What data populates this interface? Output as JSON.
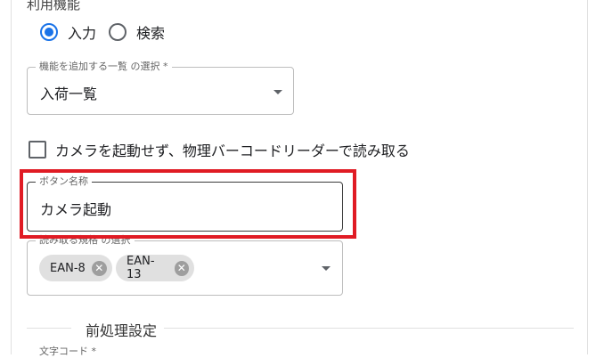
{
  "section_label": "利用機能",
  "mode": {
    "options": [
      {
        "label": "入力",
        "checked": true
      },
      {
        "label": "検索",
        "checked": false
      }
    ]
  },
  "feature_select": {
    "legend": "機能を追加する一覧 の選択 *",
    "value": "入荷一覧"
  },
  "barcode_reader_checkbox": {
    "label": "カメラを起動せず、物理バーコードリーダーで読み取る",
    "checked": false
  },
  "button_name_field": {
    "legend": "ボタン名称",
    "value": "カメラ起動"
  },
  "barcode_standard_select": {
    "legend": "読み取る規格 の選択",
    "chips": [
      "EAN-8",
      "EAN-13"
    ]
  },
  "preprocess_section": {
    "label": "前処理設定"
  },
  "next_field_label": "文字コード *",
  "colors": {
    "accent": "#1a73e8",
    "highlight": "#e01b24",
    "chip_bg": "#e0e0e0"
  }
}
